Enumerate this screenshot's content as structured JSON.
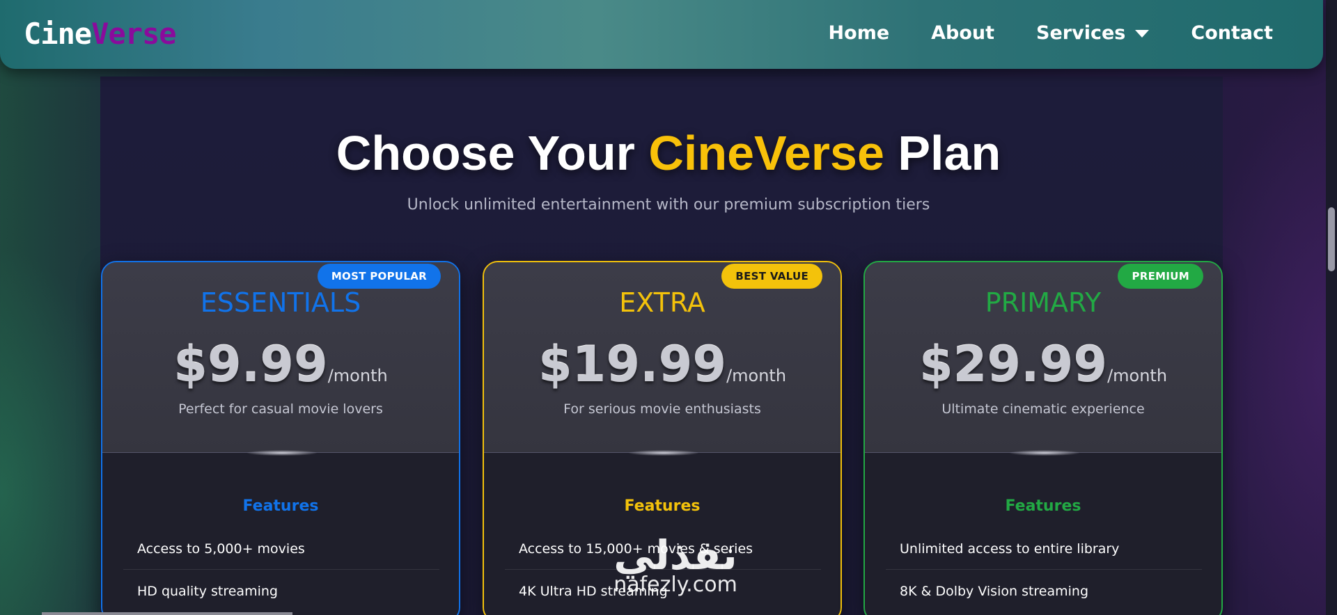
{
  "brand": {
    "part1": "Cine",
    "part2": "Verse"
  },
  "nav": {
    "home": "Home",
    "about": "About",
    "services": "Services",
    "contact": "Contact"
  },
  "hero": {
    "title_pre": "Choose Your ",
    "title_highlight": "CineVerse",
    "title_post": " Plan",
    "subtitle": "Unlock unlimited entertainment with our premium subscription tiers"
  },
  "plans": [
    {
      "badge": "MOST POPULAR",
      "name": "ESSENTIALS",
      "price": "$9.99",
      "period": "/month",
      "tagline": "Perfect for casual movie lovers",
      "features_title": "Features",
      "features": [
        "Access to 5,000+ movies",
        "HD quality streaming"
      ],
      "color": "#1173ea"
    },
    {
      "badge": "BEST VALUE",
      "name": "EXTRA",
      "price": "$19.99",
      "period": "/month",
      "tagline": "For serious movie enthusiasts",
      "features_title": "Features",
      "features": [
        "Access to 15,000+ movies & series",
        "4K Ultra HD streaming"
      ],
      "color": "#f3c20b"
    },
    {
      "badge": "PREMIUM",
      "name": "PRIMARY",
      "price": "$29.99",
      "period": "/month",
      "tagline": "Ultimate cinematic experience",
      "features_title": "Features",
      "features": [
        "Unlimited access to entire library",
        "8K & Dolby Vision streaming"
      ],
      "color": "#22a944"
    }
  ],
  "watermark": {
    "arabic": "نفذلي",
    "latin": "nafezly.com"
  }
}
